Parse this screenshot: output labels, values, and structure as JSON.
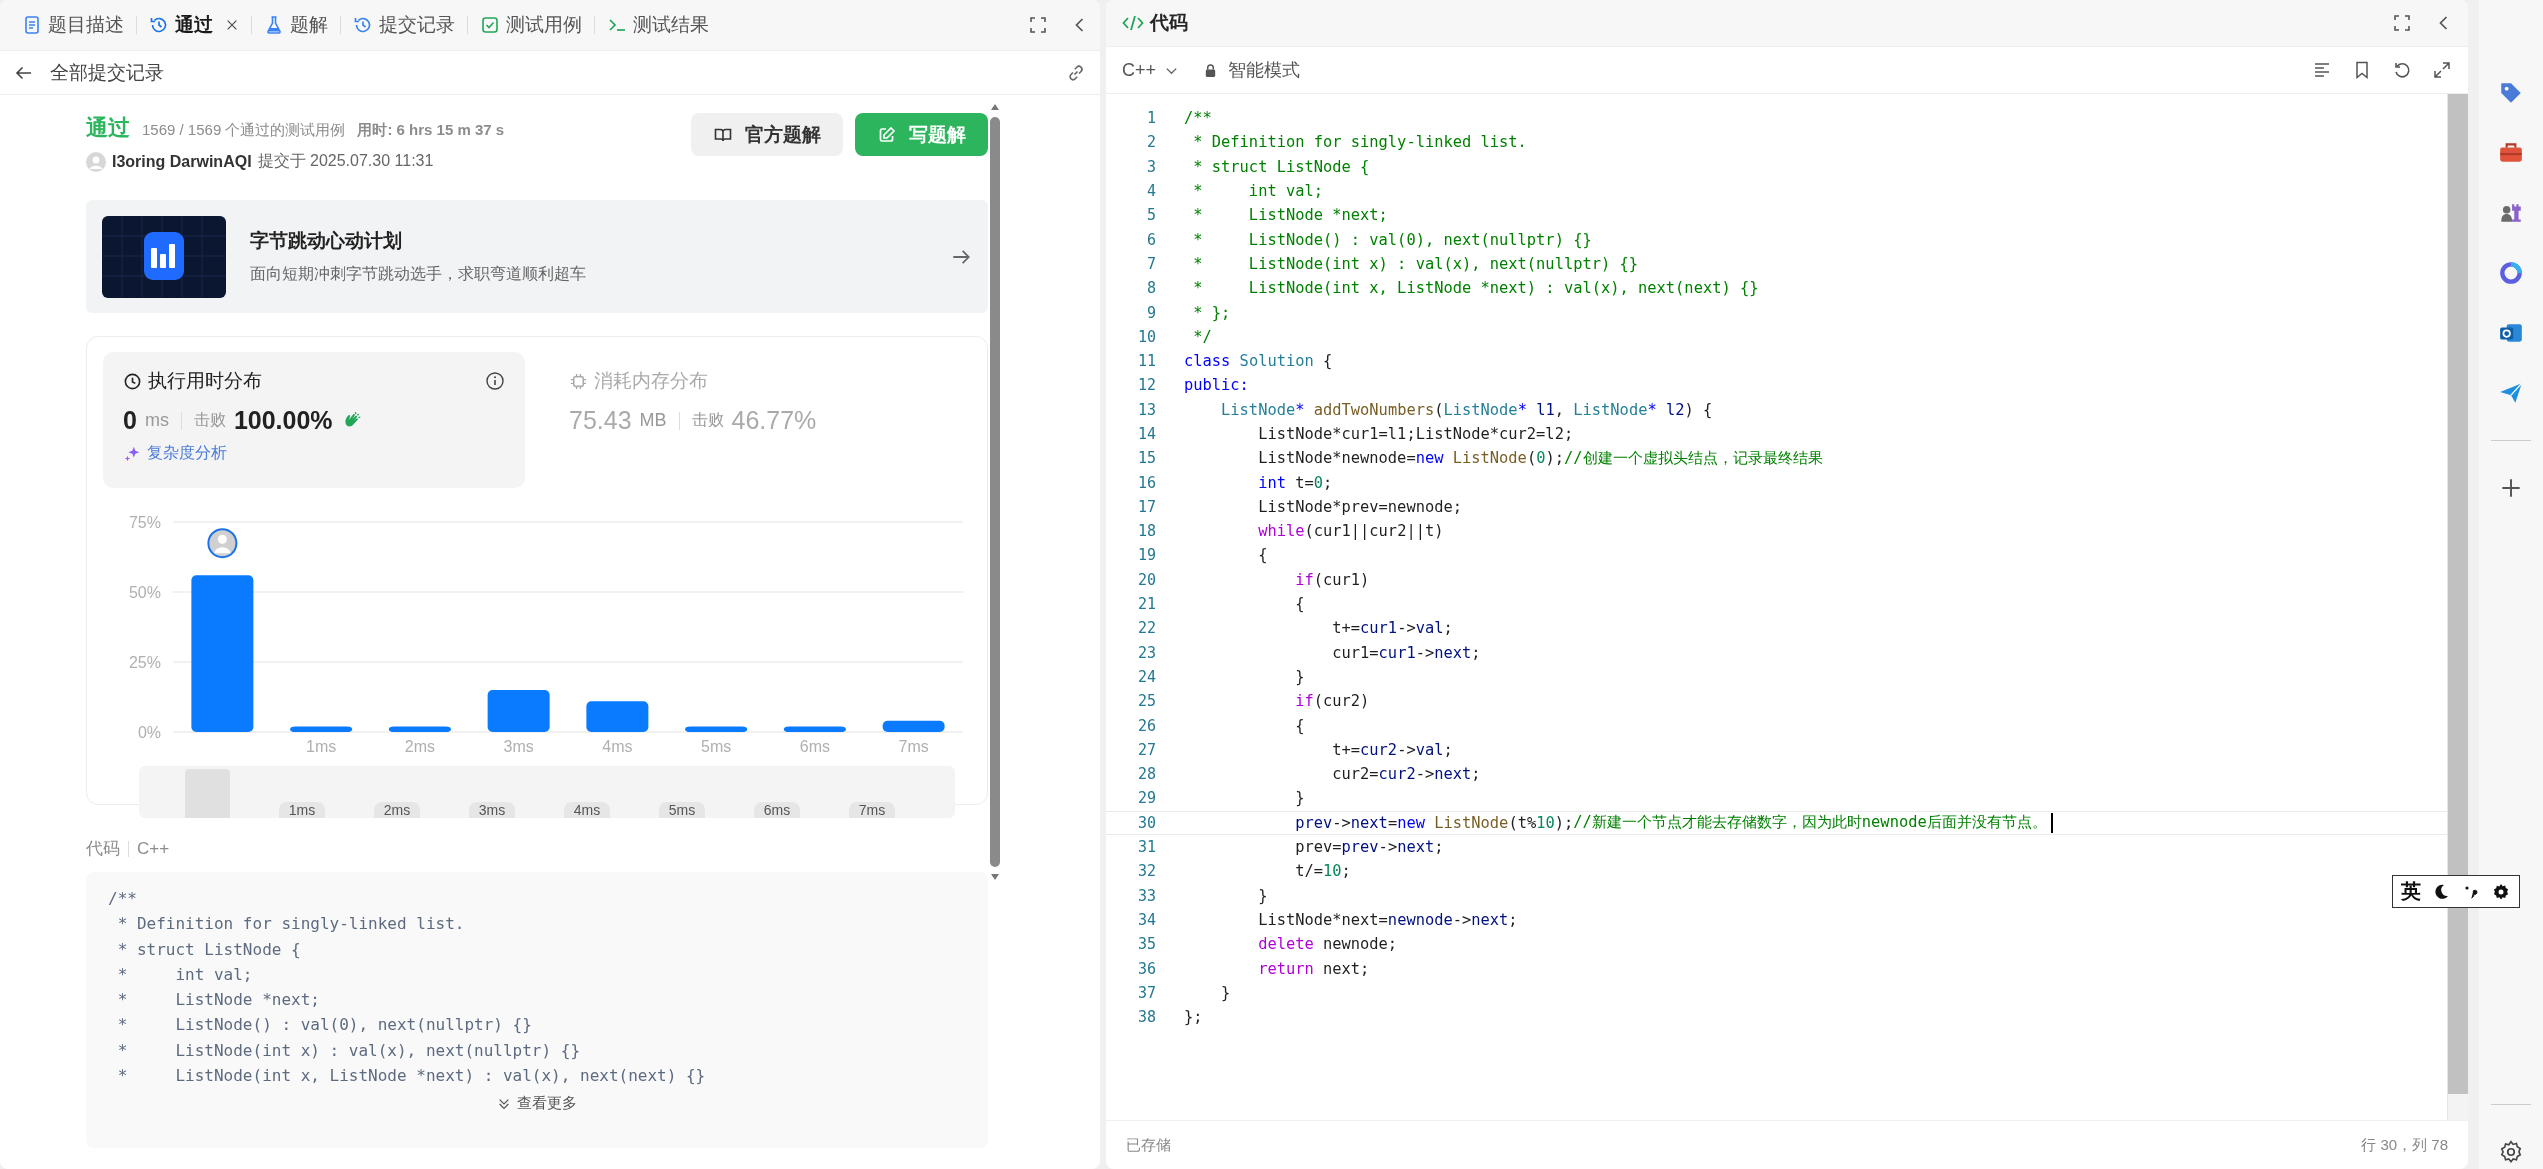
{
  "left_tabs": [
    {
      "label": "题目描述",
      "kind": "description",
      "selected": false,
      "closable": false
    },
    {
      "label": "通过",
      "kind": "submission",
      "selected": true,
      "closable": true
    },
    {
      "label": "题解",
      "kind": "solutions",
      "selected": false,
      "closable": false
    },
    {
      "label": "提交记录",
      "kind": "submission",
      "selected": false,
      "closable": false
    },
    {
      "label": "测试用例",
      "kind": "testcase",
      "selected": false,
      "closable": false
    },
    {
      "label": "测试结果",
      "kind": "result",
      "selected": false,
      "closable": false
    }
  ],
  "back_label": "全部提交记录",
  "submission": {
    "status": "通过",
    "passed": "1569 / 1569 个通过的测试用例",
    "runtime": "用时: 6 hrs 15 m 37 s",
    "user": "I3oring DarwinAQI",
    "submitted": "提交于 2025.07.30 11:31",
    "buttons": [
      {
        "label": "官方题解",
        "kind": "secondary"
      },
      {
        "label": "写题解",
        "kind": "primary"
      }
    ]
  },
  "banner": {
    "title": "字节跳动心动计划",
    "subtitle": "面向短期冲刺字节跳动选手，求职弯道顺利超车"
  },
  "stats": [
    {
      "kind": "time",
      "title": "执行用时分布",
      "value": "0",
      "unit": "ms",
      "beats_label": "击败",
      "beats": "100.00%",
      "selected": true,
      "link": "复杂度分析"
    },
    {
      "kind": "memory",
      "title": "消耗内存分布",
      "value": "75.43",
      "unit": "MB",
      "beats_label": "击败",
      "beats": "46.77%",
      "selected": false
    }
  ],
  "chart_data": {
    "type": "bar",
    "categories": [
      null,
      "1ms",
      "2ms",
      "3ms",
      "4ms",
      "5ms",
      "6ms",
      "7ms"
    ],
    "ylim": [
      0,
      75
    ],
    "yticks": [
      {
        "value": 0,
        "label": "0%"
      },
      {
        "value": 25,
        "label": "25%"
      },
      {
        "value": 50,
        "label": "50%"
      },
      {
        "value": 75,
        "label": "75%"
      }
    ],
    "series": [
      {
        "color": "#0a7bff",
        "values": [
          56,
          2,
          2,
          15,
          11,
          2,
          2,
          4
        ]
      }
    ]
  },
  "range_labels": [
    "1ms",
    "2ms",
    "3ms",
    "4ms",
    "5ms",
    "6ms",
    "7ms"
  ],
  "code_section": {
    "label": "代码",
    "language": "C++",
    "more": "查看更多",
    "lines": [
      "/**",
      " * Definition for singly-linked list.",
      " * struct ListNode {",
      " *     int val;",
      " *     ListNode *next;",
      " *     ListNode() : val(0), next(nullptr) {}",
      " *     ListNode(int x) : val(x), next(nullptr) {}",
      " *     ListNode(int x, ListNode *next) : val(x), next(next) {}"
    ]
  },
  "editor": {
    "title": "代码",
    "language": "C++",
    "mode": "智能模式",
    "status": "已存储",
    "cursor": "行 30，列 78",
    "lines": [
      {
        "no": "1",
        "current": false,
        "tokens": [
          {
            "kind": "comment",
            "text": "/**"
          }
        ]
      },
      {
        "no": "2",
        "current": false,
        "tokens": [
          {
            "kind": "comment",
            "text": " * Definition for singly-linked list."
          }
        ]
      },
      {
        "no": "3",
        "current": false,
        "tokens": [
          {
            "kind": "comment",
            "text": " * struct ListNode {"
          }
        ]
      },
      {
        "no": "4",
        "current": false,
        "tokens": [
          {
            "kind": "comment",
            "text": " *     int val;"
          }
        ]
      },
      {
        "no": "5",
        "current": false,
        "tokens": [
          {
            "kind": "comment",
            "text": " *     ListNode *next;"
          }
        ]
      },
      {
        "no": "6",
        "current": false,
        "tokens": [
          {
            "kind": "comment",
            "text": " *     ListNode() : val(0), next(nullptr) {}"
          }
        ]
      },
      {
        "no": "7",
        "current": false,
        "tokens": [
          {
            "kind": "comment",
            "text": " *     ListNode(int x) : val(x), next(nullptr) {}"
          }
        ]
      },
      {
        "no": "8",
        "current": false,
        "tokens": [
          {
            "kind": "comment",
            "text": " *     ListNode(int x, ListNode *next) : val(x), next(next) {}"
          }
        ]
      },
      {
        "no": "9",
        "current": false,
        "tokens": [
          {
            "kind": "comment",
            "text": " * };"
          }
        ]
      },
      {
        "no": "10",
        "current": false,
        "tokens": [
          {
            "kind": "comment",
            "text": " */"
          }
        ]
      },
      {
        "no": "11",
        "current": false,
        "tokens": [
          {
            "kind": "keyword",
            "text": "class "
          },
          {
            "kind": "type",
            "text": "Solution"
          },
          {
            "kind": "plain",
            "text": " {"
          }
        ]
      },
      {
        "no": "12",
        "current": false,
        "tokens": [
          {
            "kind": "keyword",
            "text": "public:"
          }
        ]
      },
      {
        "no": "13",
        "current": false,
        "tokens": [
          {
            "kind": "type",
            "text": "    ListNode"
          },
          {
            "kind": "keyword",
            "text": "*"
          },
          {
            "kind": "function",
            "text": " addTwoNumbers"
          },
          {
            "kind": "plain",
            "text": "("
          },
          {
            "kind": "type",
            "text": "ListNode"
          },
          {
            "kind": "keyword",
            "text": "*"
          },
          {
            "kind": "variable",
            "text": " l1"
          },
          {
            "kind": "plain",
            "text": ", "
          },
          {
            "kind": "type",
            "text": "ListNode"
          },
          {
            "kind": "keyword",
            "text": "*"
          },
          {
            "kind": "variable",
            "text": " l2"
          },
          {
            "kind": "plain",
            "text": ") {"
          }
        ]
      },
      {
        "no": "14",
        "current": false,
        "tokens": [
          {
            "kind": "plain",
            "text": "        ListNode*cur1=l1;ListNode*cur2=l2;"
          }
        ]
      },
      {
        "no": "15",
        "current": false,
        "tokens": [
          {
            "kind": "plain",
            "text": "        ListNode*newnode="
          },
          {
            "kind": "keyword",
            "text": "new"
          },
          {
            "kind": "function",
            "text": " ListNode"
          },
          {
            "kind": "plain",
            "text": "("
          },
          {
            "kind": "number",
            "text": "0"
          },
          {
            "kind": "plain",
            "text": ");"
          },
          {
            "kind": "comment",
            "text": "//创建一个虚拟头结点，记录最终结果"
          }
        ]
      },
      {
        "no": "16",
        "current": false,
        "tokens": [
          {
            "kind": "keyword",
            "text": "        int"
          },
          {
            "kind": "plain",
            "text": " t="
          },
          {
            "kind": "number",
            "text": "0"
          },
          {
            "kind": "plain",
            "text": ";"
          }
        ]
      },
      {
        "no": "17",
        "current": false,
        "tokens": [
          {
            "kind": "plain",
            "text": "        ListNode*prev=newnode;"
          }
        ]
      },
      {
        "no": "18",
        "current": false,
        "tokens": [
          {
            "kind": "control",
            "text": "        while"
          },
          {
            "kind": "plain",
            "text": "(cur1||cur2||t)"
          }
        ]
      },
      {
        "no": "19",
        "current": false,
        "tokens": [
          {
            "kind": "plain",
            "text": "        {"
          }
        ]
      },
      {
        "no": "20",
        "current": false,
        "tokens": [
          {
            "kind": "control",
            "text": "            if"
          },
          {
            "kind": "plain",
            "text": "(cur1)"
          }
        ]
      },
      {
        "no": "21",
        "current": false,
        "tokens": [
          {
            "kind": "plain",
            "text": "            {"
          }
        ]
      },
      {
        "no": "22",
        "current": false,
        "tokens": [
          {
            "kind": "plain",
            "text": "                t+="
          },
          {
            "kind": "variable",
            "text": "cur1"
          },
          {
            "kind": "plain",
            "text": "->"
          },
          {
            "kind": "variable",
            "text": "val"
          },
          {
            "kind": "plain",
            "text": ";"
          }
        ]
      },
      {
        "no": "23",
        "current": false,
        "tokens": [
          {
            "kind": "plain",
            "text": "                cur1="
          },
          {
            "kind": "variable",
            "text": "cur1"
          },
          {
            "kind": "plain",
            "text": "->"
          },
          {
            "kind": "variable",
            "text": "next"
          },
          {
            "kind": "plain",
            "text": ";"
          }
        ]
      },
      {
        "no": "24",
        "current": false,
        "tokens": [
          {
            "kind": "plain",
            "text": "            }"
          }
        ]
      },
      {
        "no": "25",
        "current": false,
        "tokens": [
          {
            "kind": "control",
            "text": "            if"
          },
          {
            "kind": "plain",
            "text": "(cur2)"
          }
        ]
      },
      {
        "no": "26",
        "current": false,
        "tokens": [
          {
            "kind": "plain",
            "text": "            {"
          }
        ]
      },
      {
        "no": "27",
        "current": false,
        "tokens": [
          {
            "kind": "plain",
            "text": "                t+="
          },
          {
            "kind": "variable",
            "text": "cur2"
          },
          {
            "kind": "plain",
            "text": "->"
          },
          {
            "kind": "variable",
            "text": "val"
          },
          {
            "kind": "plain",
            "text": ";"
          }
        ]
      },
      {
        "no": "28",
        "current": false,
        "tokens": [
          {
            "kind": "plain",
            "text": "                cur2="
          },
          {
            "kind": "variable",
            "text": "cur2"
          },
          {
            "kind": "plain",
            "text": "->"
          },
          {
            "kind": "variable",
            "text": "next"
          },
          {
            "kind": "plain",
            "text": ";"
          }
        ]
      },
      {
        "no": "29",
        "current": false,
        "tokens": [
          {
            "kind": "plain",
            "text": "            }"
          }
        ]
      },
      {
        "no": "30",
        "current": true,
        "tokens": [
          {
            "kind": "variable",
            "text": "            prev"
          },
          {
            "kind": "plain",
            "text": "->"
          },
          {
            "kind": "variable",
            "text": "next"
          },
          {
            "kind": "plain",
            "text": "="
          },
          {
            "kind": "keyword",
            "text": "new"
          },
          {
            "kind": "function",
            "text": " ListNode"
          },
          {
            "kind": "plain",
            "text": "(t%"
          },
          {
            "kind": "number",
            "text": "10"
          },
          {
            "kind": "plain",
            "text": ");"
          },
          {
            "kind": "comment",
            "text": "//新建一个节点才能去存储数字，因为此时newnode后面并没有节点。"
          }
        ]
      },
      {
        "no": "31",
        "current": false,
        "tokens": [
          {
            "kind": "plain",
            "text": "            prev="
          },
          {
            "kind": "variable",
            "text": "prev"
          },
          {
            "kind": "plain",
            "text": "->"
          },
          {
            "kind": "variable",
            "text": "next"
          },
          {
            "kind": "plain",
            "text": ";"
          }
        ]
      },
      {
        "no": "32",
        "current": false,
        "tokens": [
          {
            "kind": "plain",
            "text": "            t/="
          },
          {
            "kind": "number",
            "text": "10"
          },
          {
            "kind": "plain",
            "text": ";"
          }
        ]
      },
      {
        "no": "33",
        "current": false,
        "tokens": [
          {
            "kind": "plain",
            "text": "        }"
          }
        ]
      },
      {
        "no": "34",
        "current": false,
        "tokens": [
          {
            "kind": "plain",
            "text": "        ListNode*next="
          },
          {
            "kind": "variable",
            "text": "newnode"
          },
          {
            "kind": "plain",
            "text": "->"
          },
          {
            "kind": "variable",
            "text": "next"
          },
          {
            "kind": "plain",
            "text": ";"
          }
        ]
      },
      {
        "no": "35",
        "current": false,
        "tokens": [
          {
            "kind": "control",
            "text": "        delete"
          },
          {
            "kind": "plain",
            "text": " newnode;"
          }
        ]
      },
      {
        "no": "36",
        "current": false,
        "tokens": [
          {
            "kind": "control",
            "text": "        return"
          },
          {
            "kind": "plain",
            "text": " next;"
          }
        ]
      },
      {
        "no": "37",
        "current": false,
        "tokens": [
          {
            "kind": "plain",
            "text": "    }"
          }
        ]
      },
      {
        "no": "38",
        "current": false,
        "tokens": [
          {
            "kind": "plain",
            "text": "};"
          }
        ]
      }
    ]
  },
  "ime": {
    "label": "英"
  }
}
